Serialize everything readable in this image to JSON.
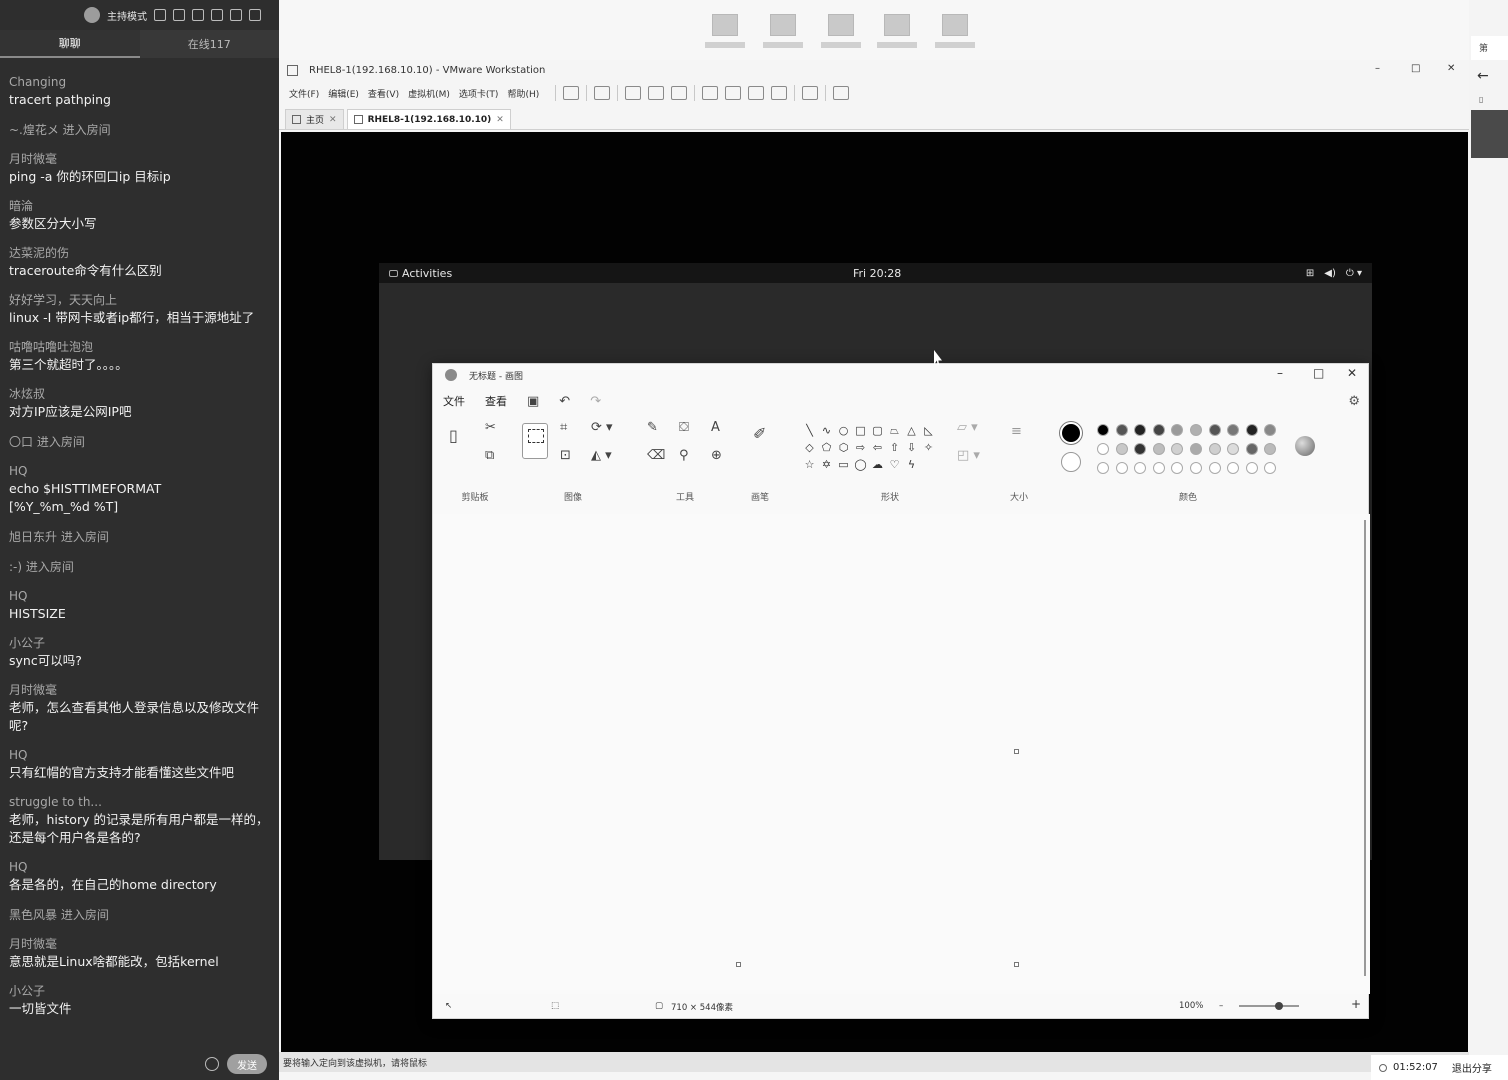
{
  "chat": {
    "title": "主持模式",
    "tabs": [
      "聊聊",
      "在线117"
    ],
    "messages": [
      {
        "user": "Changing",
        "text": "tracert pathping"
      },
      {
        "system": "~.煌花メ   进入房间"
      },
      {
        "user": "月时微毫",
        "text": "ping  -a  你的环回口ip  目标ip"
      },
      {
        "user": "暗淪",
        "text": "参数区分大小写"
      },
      {
        "user": "达菜泥的伤",
        "text": "traceroute命令有什么区别"
      },
      {
        "user": "好好学习，天天向上",
        "text": "linux -I 带网卡或者ip都行，相当于源地址了"
      },
      {
        "user": "咕噜咕噜吐泡泡",
        "text": "第三个就超时了。。。。"
      },
      {
        "user": "冰炫叔",
        "text": "对方IP应该是公网IP吧"
      },
      {
        "system": "〇口 进入房间"
      },
      {
        "user": "HQ",
        "text": "echo $HISTTIMEFORMAT\n[%Y_%m_%d %T]"
      },
      {
        "system": "旭日东升 进入房间"
      },
      {
        "system": ":-)   进入房间"
      },
      {
        "user": "HQ",
        "text": "HISTSIZE"
      },
      {
        "user": "小公子",
        "text": "sync可以吗?"
      },
      {
        "user": "月时微毫",
        "text": "老师，怎么查看其他人登录信息以及修改文件呢?"
      },
      {
        "user": "HQ",
        "text": "只有红帽的官方支持才能看懂这些文件吧"
      },
      {
        "user": "struggle to th...",
        "text": "老师，history 的记录是所有用户都是一样的，还是每个用户各是各的?"
      },
      {
        "user": "HQ",
        "text": "各是各的，在自己的home directory"
      },
      {
        "system": "黑色风暴 进入房间"
      },
      {
        "user": "月时微毫",
        "text": "意思就是Linux啥都能改，包括kernel"
      },
      {
        "user": "小公子",
        "text": "一切皆文件"
      }
    ],
    "send_label": "发送"
  },
  "vmware": {
    "title": "RHEL8-1(192.168.10.10) - VMware Workstation",
    "menu": [
      "文件(F)",
      "编辑(E)",
      "查看(V)",
      "虚拟机(M)",
      "选项卡(T)",
      "帮助(H)"
    ],
    "tabs": [
      {
        "label": "主页"
      },
      {
        "label": "RHEL8-1(192.168.10.10)"
      }
    ],
    "status_text": "要将输入定向到该虚拟机，请将鼠标"
  },
  "gnome": {
    "activities": "Activities",
    "clock": "Fri 20:28"
  },
  "paint": {
    "title": "无标题 - 画图",
    "menu": [
      "文件",
      "查看"
    ],
    "groups": [
      "剪贴板",
      "图像",
      "工具",
      "画笔",
      "形状",
      "大小",
      "颜色"
    ],
    "palette": [
      "#000000",
      "#555555",
      "#222222",
      "#444444",
      "#9a9a9a",
      "#b0b0b0",
      "#555555",
      "#777777",
      "#222222",
      "#888888",
      "#ffffff",
      "#c8c8c8",
      "#333333",
      "#bdbdbd",
      "#d0d0d0",
      "#aaaaaa",
      "#cfcfcf",
      "#dcdcdc",
      "#666666",
      "#bbbbbb",
      "#ffffff",
      "#ffffff",
      "#ffffff",
      "#ffffff",
      "#ffffff",
      "#ffffff",
      "#ffffff",
      "#ffffff",
      "#ffffff",
      "#ffffff"
    ],
    "canvas_size": "710 × 544像素",
    "zoom": "100%"
  },
  "browser": {
    "tab_label": "第"
  },
  "share": {
    "timer": "01:52:07",
    "exit_label": "退出分享"
  }
}
